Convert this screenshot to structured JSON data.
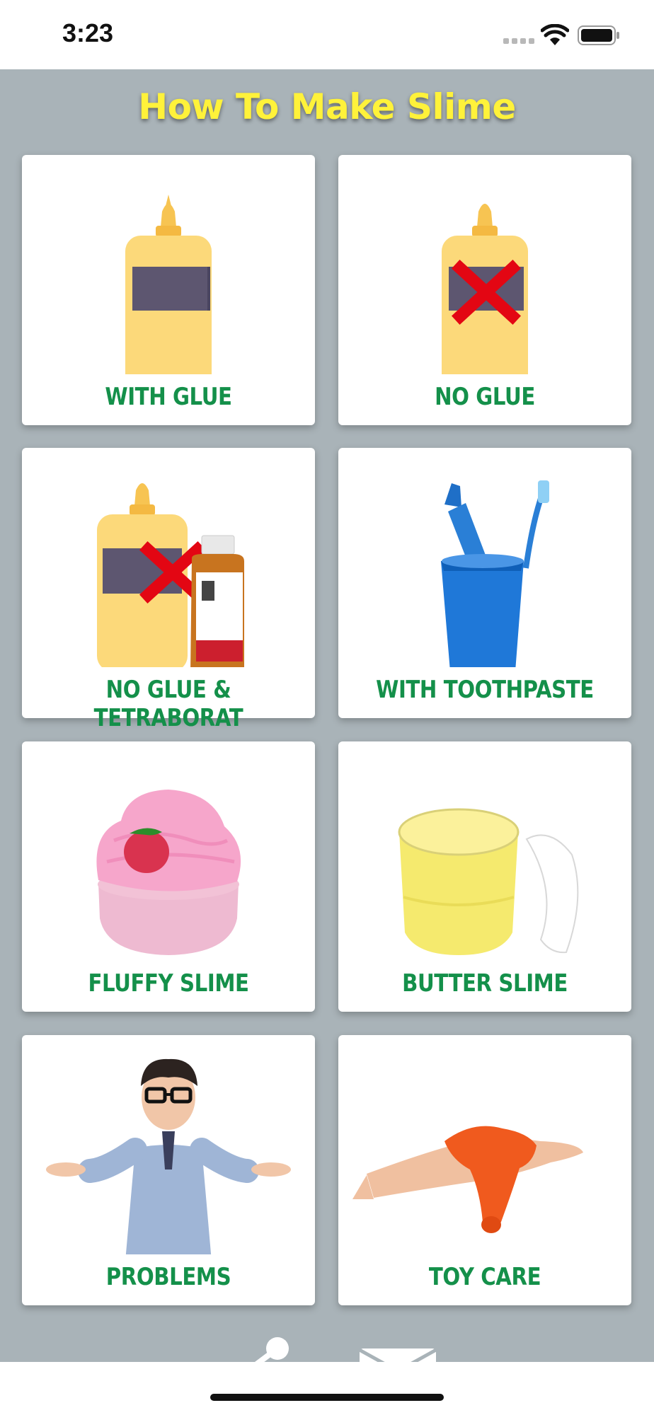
{
  "status_bar": {
    "time": "3:23"
  },
  "header": {
    "title": "How To Make Slime"
  },
  "cards": [
    {
      "label": "WITH GLUE",
      "icon": "glue-bottle-icon"
    },
    {
      "label": "NO GLUE",
      "icon": "no-glue-icon"
    },
    {
      "label": "NO GLUE & TETRABORAT",
      "icon": "no-glue-tetraborat-icon"
    },
    {
      "label": "WITH TOOTHPASTE",
      "icon": "toothpaste-cup-icon"
    },
    {
      "label": "FLUFFY SLIME",
      "icon": "fluffy-slime-icon"
    },
    {
      "label": "BUTTER SLIME",
      "icon": "butter-slime-icon"
    },
    {
      "label": "PROBLEMS",
      "icon": "shrugging-person-icon"
    },
    {
      "label": "TOY CARE",
      "icon": "slime-hand-icon"
    }
  ],
  "colors": {
    "background": "#a9b3b8",
    "title": "#fff23a",
    "label": "#14904a",
    "glue_bottle": "#f9d56c",
    "glue_label": "#5d5670",
    "cross": "#e30613"
  }
}
